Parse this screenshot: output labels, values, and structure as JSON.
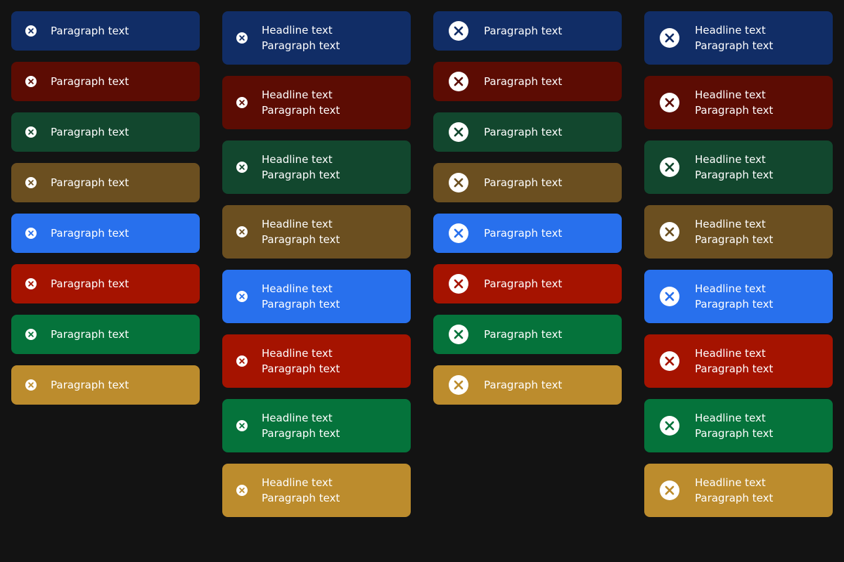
{
  "variants": [
    {
      "bg": "#112d66",
      "x": "#112d66"
    },
    {
      "bg": "#5c0c03",
      "x": "#5c0c03"
    },
    {
      "bg": "#12472e",
      "x": "#12472e"
    },
    {
      "bg": "#6b4f20",
      "x": "#6b4f20"
    },
    {
      "bg": "#2870ed",
      "x": "#2870ed"
    },
    {
      "bg": "#a51300",
      "x": "#a51300"
    },
    {
      "bg": "#05733b",
      "x": "#05733b"
    },
    {
      "bg": "#bc8c2d",
      "x": "#bc8c2d"
    }
  ],
  "icon": "close-circle-icon",
  "column1": {
    "items": [
      {
        "paragraph": "Paragraph text"
      },
      {
        "paragraph": "Paragraph text"
      },
      {
        "paragraph": "Paragraph text"
      },
      {
        "paragraph": "Paragraph text"
      },
      {
        "paragraph": "Paragraph text"
      },
      {
        "paragraph": "Paragraph text"
      },
      {
        "paragraph": "Paragraph text"
      },
      {
        "paragraph": "Paragraph text"
      }
    ]
  },
  "column2": {
    "items": [
      {
        "headline": "Headline text",
        "paragraph": "Paragraph text"
      },
      {
        "headline": "Headline text",
        "paragraph": "Paragraph text"
      },
      {
        "headline": "Headline text",
        "paragraph": "Paragraph text"
      },
      {
        "headline": "Headline text",
        "paragraph": "Paragraph text"
      },
      {
        "headline": "Headline text",
        "paragraph": "Paragraph text"
      },
      {
        "headline": "Headline text",
        "paragraph": "Paragraph text"
      },
      {
        "headline": "Headline text",
        "paragraph": "Paragraph text"
      },
      {
        "headline": "Headline text",
        "paragraph": "Paragraph text"
      }
    ]
  },
  "column3": {
    "items": [
      {
        "paragraph": "Paragraph text"
      },
      {
        "paragraph": "Paragraph text"
      },
      {
        "paragraph": "Paragraph text"
      },
      {
        "paragraph": "Paragraph text"
      },
      {
        "paragraph": "Paragraph text"
      },
      {
        "paragraph": "Paragraph text"
      },
      {
        "paragraph": "Paragraph text"
      },
      {
        "paragraph": "Paragraph text"
      }
    ]
  },
  "column4": {
    "items": [
      {
        "headline": "Headline text",
        "paragraph": "Paragraph text"
      },
      {
        "headline": "Headline text",
        "paragraph": "Paragraph text"
      },
      {
        "headline": "Headline text",
        "paragraph": "Paragraph text"
      },
      {
        "headline": "Headline text",
        "paragraph": "Paragraph text"
      },
      {
        "headline": "Headline text",
        "paragraph": "Paragraph text"
      },
      {
        "headline": "Headline text",
        "paragraph": "Paragraph text"
      },
      {
        "headline": "Headline text",
        "paragraph": "Paragraph text"
      },
      {
        "headline": "Headline text",
        "paragraph": "Paragraph text"
      }
    ]
  }
}
